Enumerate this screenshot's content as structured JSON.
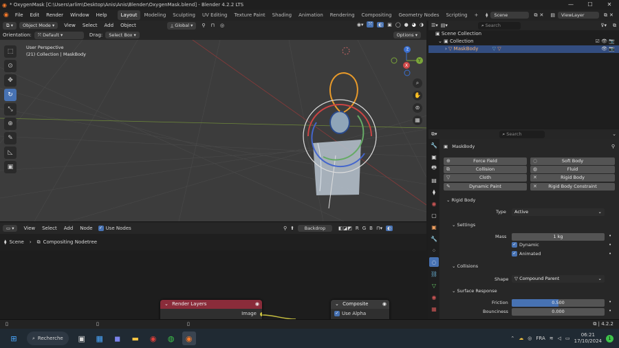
{
  "window": {
    "title": "* OxygenMask [C:\\Users\\arlim\\Desktop\\Anis\\Anis\\Blender\\OxygenMask.blend] - Blender 4.2.2 LTS",
    "min": "—",
    "max": "☐",
    "close": "✕"
  },
  "menu": [
    "File",
    "Edit",
    "Render",
    "Window",
    "Help"
  ],
  "workspaces": [
    "Layout",
    "Modeling",
    "Sculpting",
    "UV Editing",
    "Texture Paint",
    "Shading",
    "Animation",
    "Rendering",
    "Compositing",
    "Geometry Nodes",
    "Scripting"
  ],
  "scene_label": "Scene",
  "viewlayer_label": "ViewLayer",
  "viewport": {
    "mode": "Object Mode",
    "view": "View",
    "select": "Select",
    "add": "Add",
    "object": "Object",
    "transform": "Global",
    "orientation_label": "Orientation:",
    "orientation_value": "Default",
    "drag_label": "Drag:",
    "drag_value": "Select Box",
    "options": "Options",
    "perspective": "User Perspective",
    "collection_info": "(21) Collection | MaskBody"
  },
  "node_editor": {
    "view": "View",
    "select": "Select",
    "add": "Add",
    "node": "Node",
    "use_nodes": "Use Nodes",
    "backdrop": "Backdrop",
    "channels": [
      "R",
      "G",
      "B"
    ],
    "breadcrumb_scene": "Scene",
    "breadcrumb_tree": "Compositing Nodetree",
    "render_layers": {
      "title": "Render Layers",
      "output": "Image"
    },
    "composite": {
      "title": "Composite",
      "use_alpha": "Use Alpha"
    }
  },
  "outliner": {
    "search_placeholder": "Search",
    "scene_collection": "Scene Collection",
    "collection": "Collection",
    "object": "MaskBody"
  },
  "properties": {
    "search_placeholder": "Search",
    "object_name": "MaskBody",
    "physics_buttons": [
      {
        "label": "Force Field",
        "icon": "⊕"
      },
      {
        "label": "Soft Body",
        "icon": "◌"
      },
      {
        "label": "Collision",
        "icon": "⧉"
      },
      {
        "label": "Fluid",
        "icon": "◍"
      },
      {
        "label": "Cloth",
        "icon": "▽"
      },
      {
        "label": "Rigid Body",
        "icon": "✕"
      },
      {
        "label": "Dynamic Paint",
        "icon": "✎"
      },
      {
        "label": "Rigid Body Constraint",
        "icon": "✕"
      }
    ],
    "rigid_body": "Rigid Body",
    "type_label": "Type",
    "type_value": "Active",
    "settings": "Settings",
    "mass_label": "Mass",
    "mass_value": "1 kg",
    "dynamic": "Dynamic",
    "animated": "Animated",
    "collisions": "Collisions",
    "shape_label": "Shape",
    "shape_value": "Compound Parent",
    "surface_response": "Surface Response",
    "friction_label": "Friction",
    "friction_value": "0.500",
    "friction_level": 0.5,
    "bounciness_label": "Bounciness",
    "bounciness_value": "0.000"
  },
  "status": {
    "version": "4.2.2"
  },
  "taskbar": {
    "search": "Recherche",
    "lang": "FRA",
    "time": "06:21",
    "date": "17/10/2024",
    "notifications": "1"
  },
  "colors": {
    "accent": "#4772b3",
    "render_layers_header": "#8a2c3a",
    "composite_header": "#3a3a3a",
    "selected_row": "#334d80"
  }
}
